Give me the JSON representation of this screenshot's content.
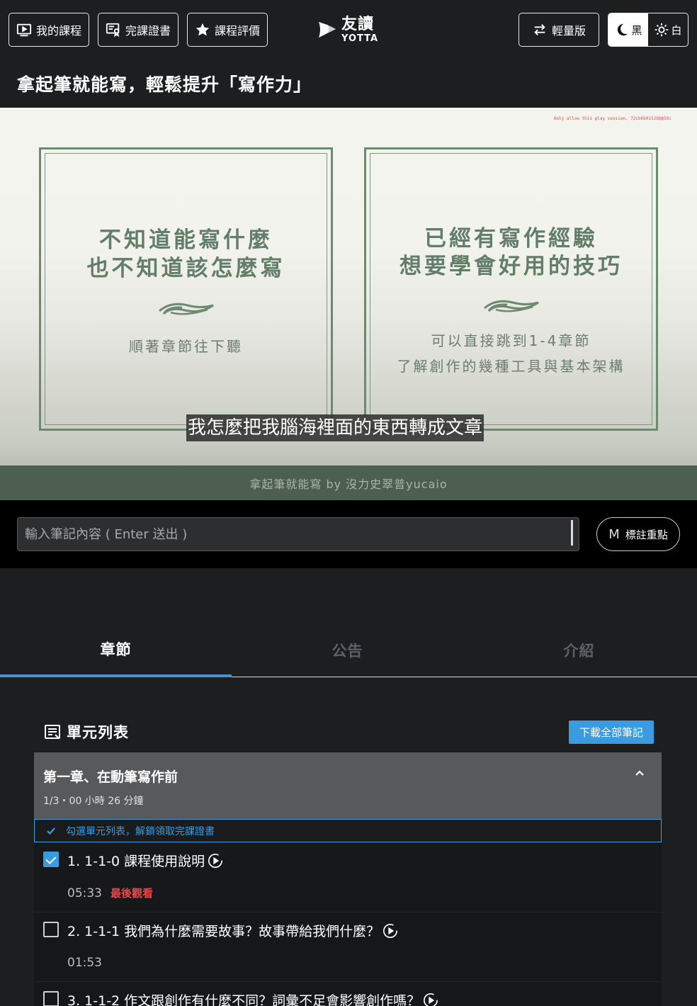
{
  "header": {
    "my_courses": "我的課程",
    "certificate": "完課證書",
    "rating": "課程評價",
    "logo_cn": "友讀",
    "logo_en": "YOTTA",
    "lite": "輕量版",
    "theme_dark": "黑",
    "theme_light": "白"
  },
  "course": {
    "title": "拿起筆就能寫，輕鬆提升「寫作力」"
  },
  "video": {
    "watermark": "Only allow this play session. 72cb6b0152bbb58c",
    "card_left": {
      "line1": "不知道能寫什麼",
      "line2": "也不知道該怎麼寫",
      "sub": "順著章節往下聽"
    },
    "card_right": {
      "line1": "已經有寫作經驗",
      "line2": "想要學會好用的技巧",
      "sub1": "可以直接跳到1-4章節",
      "sub2": "了解創作的幾種工具與基本架構"
    },
    "subtitle": "我怎麼把我腦海裡面的東西轉成文章",
    "footer": "拿起筆就能寫 by 沒力史翠普yucaio"
  },
  "notes": {
    "placeholder": "輸入筆記內容 ( Enter 送出 )",
    "mark_key": "M",
    "mark_label": "標註重點"
  },
  "tabs": [
    {
      "label": "章節",
      "active": true
    },
    {
      "label": "公告",
      "active": false
    },
    {
      "label": "介紹",
      "active": false
    }
  ],
  "units": {
    "header": "單元列表",
    "download": "下載全部筆記",
    "chapter": {
      "title": "第一章、在動筆寫作前",
      "meta": "1/3・00 小時 26 分鐘"
    },
    "hint": "勾選單元列表，解鎖領取完課證書",
    "lessons": [
      {
        "title": "1. 1-1-0 課程使用說明",
        "duration": "05:33",
        "last_watched": "最後觀看",
        "checked": true
      },
      {
        "title": "2. 1-1-1 我們為什麼需要故事？故事帶給我們什麼？",
        "duration": "01:53",
        "last_watched": "",
        "checked": false
      },
      {
        "title": "3. 1-1-2 作文跟創作有什麼不同？詞彙不足會影響創作嗎？",
        "duration": "",
        "last_watched": "",
        "checked": false
      }
    ]
  },
  "colors": {
    "accent": "#3b9be0",
    "card_green": "#627e69",
    "last_watched": "#e04a4a"
  }
}
